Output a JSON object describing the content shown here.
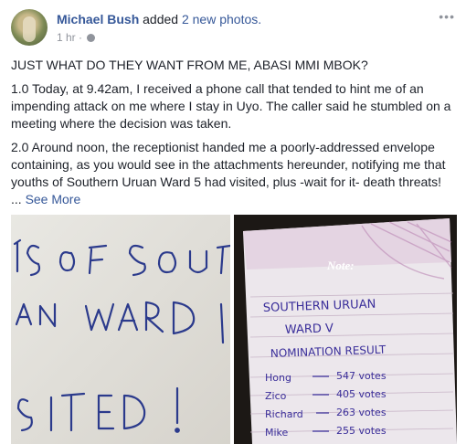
{
  "post": {
    "author": "Michael Bush",
    "action_text": "added",
    "photos_link": "2 new photos.",
    "time": "1 hr",
    "more_icon": "ellipsis-icon",
    "paragraphs": [
      "JUST WHAT DO THEY WANT FROM ME, ABASI MMI MBOK?",
      "1.0 Today, at 9.42am, I received a phone call that tended to hint me of an impending attack on me where I stay in Uyo. The caller said he stumbled on a meeting where the decision was taken.",
      "2.0 Around noon, the receptionist handed me a poorly-addressed envelope containing, as you would see in the attachments hereunder, notifying me that youths of Southern Uruan Ward 5 had visited, plus -wait for it- death threats!"
    ],
    "ellipsis": "...",
    "see_more": "See More"
  },
  "photo1": {
    "lines": [
      "TS OF SOUT",
      "UAN WARD",
      "SITED !"
    ]
  },
  "photo2": {
    "note_label": "Note:",
    "lines": [
      "SOUTHERN URUAN",
      "WARD V",
      "NOMINATION RESULT"
    ],
    "rows": [
      {
        "name": "Hong",
        "votes": "547 votes"
      },
      {
        "name": "Zico",
        "votes": "405 votes"
      },
      {
        "name": "Richard",
        "votes": "263 votes"
      },
      {
        "name": "Mike",
        "votes": "255 votes"
      }
    ]
  }
}
